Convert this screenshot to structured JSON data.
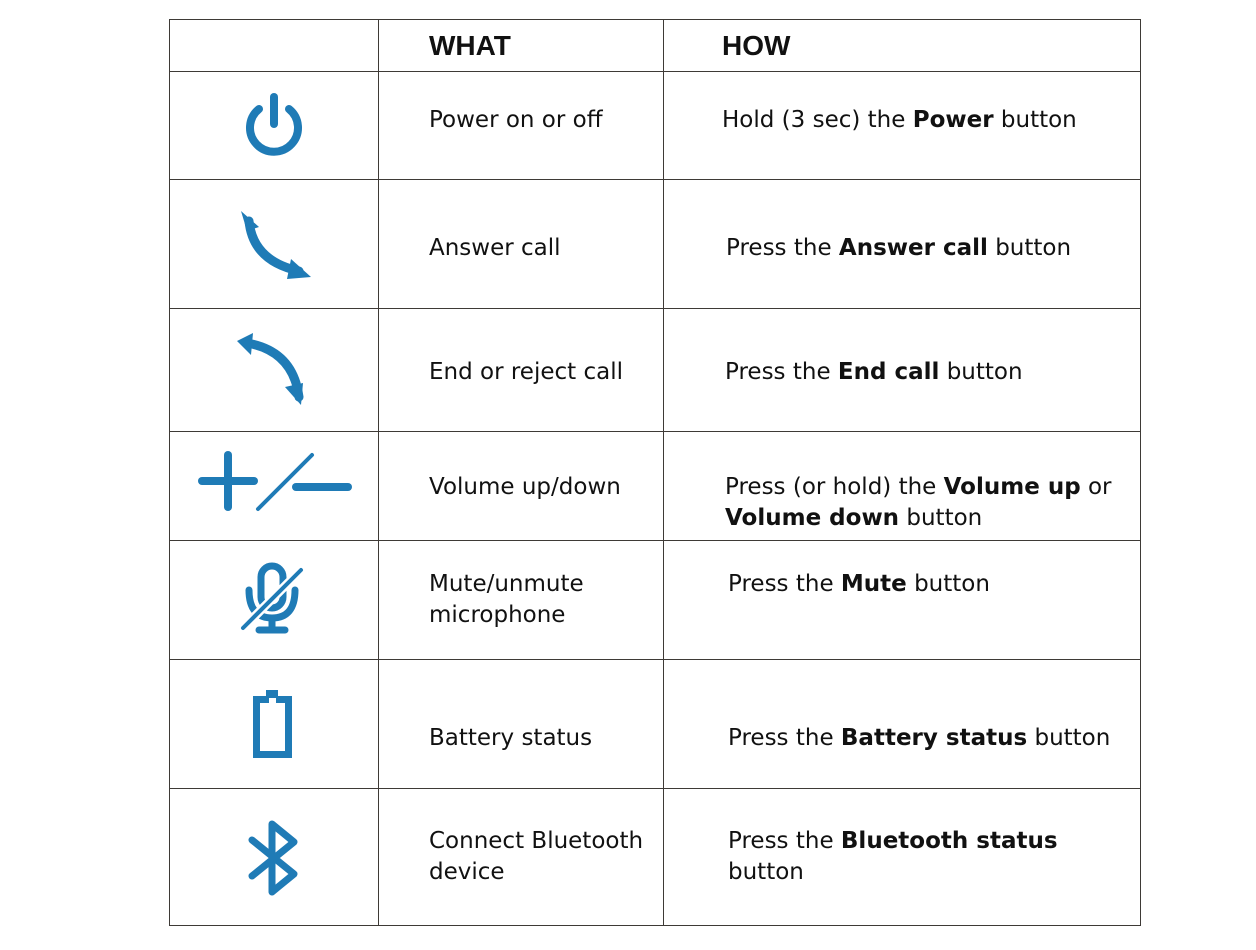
{
  "header": {
    "col1": "",
    "col2": "WHAT",
    "col3": "HOW"
  },
  "accent_color": "#1f7bb6",
  "rows": [
    {
      "icon": "power-icon",
      "what": "Power on or off",
      "how": {
        "pre": "Hold (3 sec) the ",
        "bold": "Power",
        "post": " button"
      }
    },
    {
      "icon": "answer-call-icon",
      "what": "Answer call",
      "how": {
        "pre": "Press the ",
        "bold": "Answer call",
        "post": " button"
      }
    },
    {
      "icon": "end-call-icon",
      "what": "End or reject call",
      "how": {
        "pre": "Press the ",
        "bold": "End call",
        "post": " button"
      }
    },
    {
      "icon": "volume-plus-minus-icon",
      "what": "Volume up/down",
      "how": {
        "pre": "Press (or hold) the ",
        "bold": "Volume up",
        "mid": " or ",
        "bold2": "Volume down",
        "post": " button"
      }
    },
    {
      "icon": "mute-microphone-icon",
      "what_line1": "Mute/unmute",
      "what_line2": "microphone",
      "how": {
        "pre": "Press the ",
        "bold": "Mute",
        "post": " button"
      }
    },
    {
      "icon": "battery-icon",
      "what": "Battery status",
      "how": {
        "pre": "Press the ",
        "bold": "Battery status",
        "post": " button"
      }
    },
    {
      "icon": "bluetooth-icon",
      "what_line1": "Connect Bluetooth",
      "what_line2": "device",
      "how": {
        "pre": "Press the ",
        "bold": "Bluetooth status",
        "post": " button"
      }
    }
  ]
}
